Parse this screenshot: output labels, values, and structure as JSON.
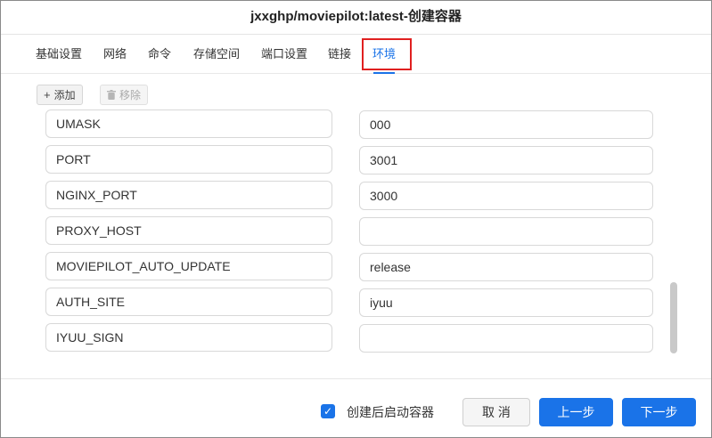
{
  "window": {
    "title": "jxxghp/moviepilot:latest-创建容器"
  },
  "tabs": [
    {
      "label": "基础设置"
    },
    {
      "label": "网络"
    },
    {
      "label": "命令"
    },
    {
      "label": "存储空间"
    },
    {
      "label": "端口设置"
    },
    {
      "label": "链接"
    },
    {
      "label": "环境",
      "active": true
    }
  ],
  "toolbar": {
    "add_label": "添加",
    "remove_label": "移除"
  },
  "env_vars": [
    {
      "key": "UMASK",
      "value": "000"
    },
    {
      "key": "PORT",
      "value": "3001"
    },
    {
      "key": "NGINX_PORT",
      "value": "3000"
    },
    {
      "key": "PROXY_HOST",
      "value": ""
    },
    {
      "key": "MOVIEPILOT_AUTO_UPDATE",
      "value": "release"
    },
    {
      "key": "AUTH_SITE",
      "value": "iyuu"
    },
    {
      "key": "IYUU_SIGN",
      "value": ""
    }
  ],
  "footer": {
    "start_after_create_label": "创建后启动容器",
    "start_after_create_checked": true,
    "cancel_label": "取 消",
    "prev_label": "上一步",
    "next_label": "下一步"
  },
  "colors": {
    "accent": "#1a73e8",
    "highlight": "#e02020"
  },
  "icons": {
    "add": "plus-icon",
    "remove": "trash-icon",
    "checkbox": "checkmark-icon"
  }
}
